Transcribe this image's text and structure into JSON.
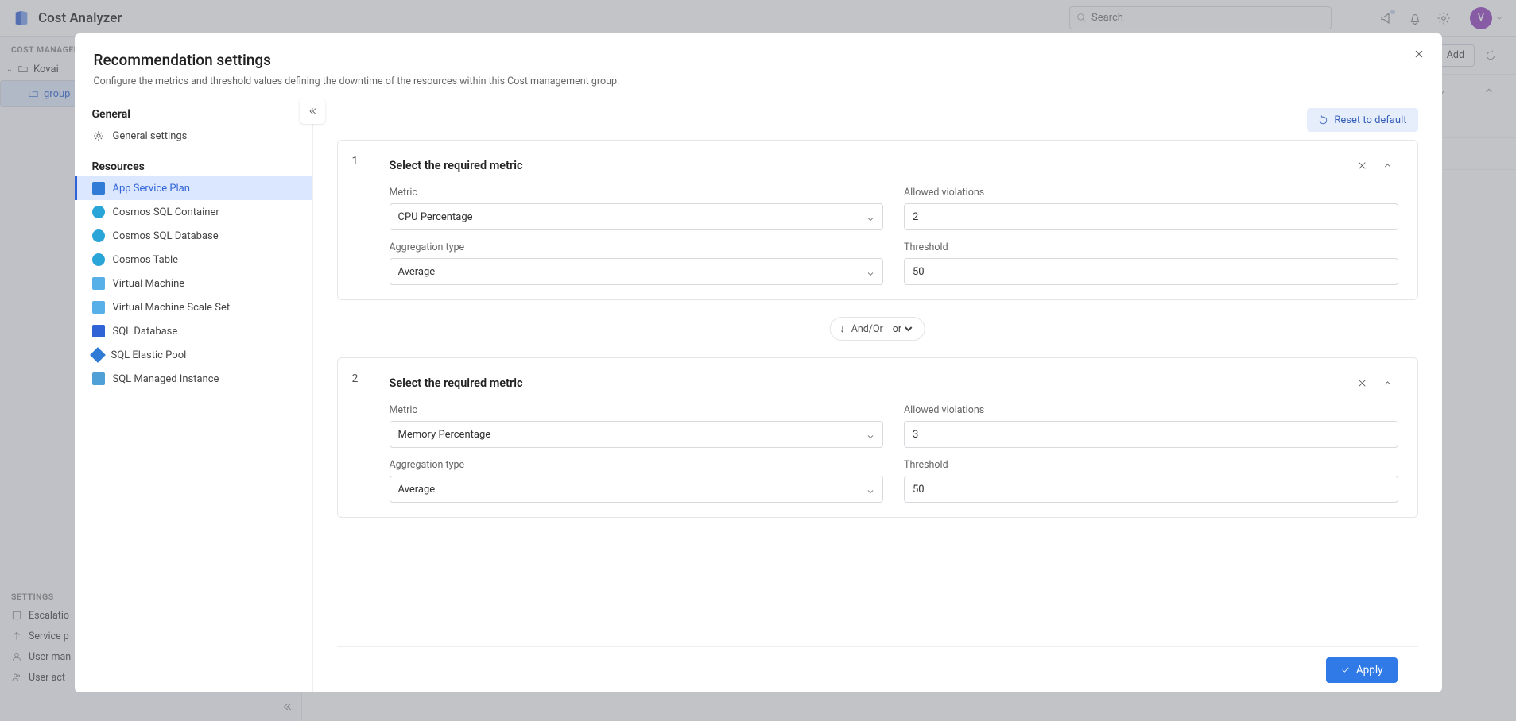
{
  "app": {
    "title": "Cost Analyzer",
    "search_placeholder": "Search",
    "avatar_initial": "V"
  },
  "sidebar_bg": {
    "section1": "COST MANAGEMENT",
    "tree": {
      "root_label": "Kovai",
      "child_label": "group"
    },
    "settings_header": "SETTINGS",
    "settings_items": {
      "a": "Escalatio",
      "b": "Service p",
      "c": "User man",
      "d": "User act"
    }
  },
  "main_bg": {
    "add_label": "Add"
  },
  "modal": {
    "title": "Recommendation settings",
    "subtitle": "Configure the metrics and threshold values defining the downtime of the resources within this Cost management group.",
    "side": {
      "general_header": "General",
      "general_settings": "General settings",
      "resources_header": "Resources",
      "items": {
        "0": "App Service Plan",
        "1": "Cosmos SQL Container",
        "2": "Cosmos SQL Database",
        "3": "Cosmos Table",
        "4": "Virtual Machine",
        "5": "Virtual Machine Scale Set",
        "6": "SQL Database",
        "7": "SQL Elastic Pool",
        "8": "SQL Managed Instance"
      }
    },
    "reset_label": "Reset to default",
    "card_title": "Select the required metric",
    "labels": {
      "metric": "Metric",
      "violations": "Allowed violations",
      "agg": "Aggregation type",
      "threshold": "Threshold"
    },
    "card1": {
      "num": "1",
      "metric": "CPU Percentage",
      "violations": "2",
      "agg": "Average",
      "threshold": "50"
    },
    "card2": {
      "num": "2",
      "metric": "Memory Percentage",
      "violations": "3",
      "agg": "Average",
      "threshold": "50"
    },
    "andor": {
      "label": "And/Or",
      "value": "or"
    },
    "apply_label": "Apply"
  }
}
